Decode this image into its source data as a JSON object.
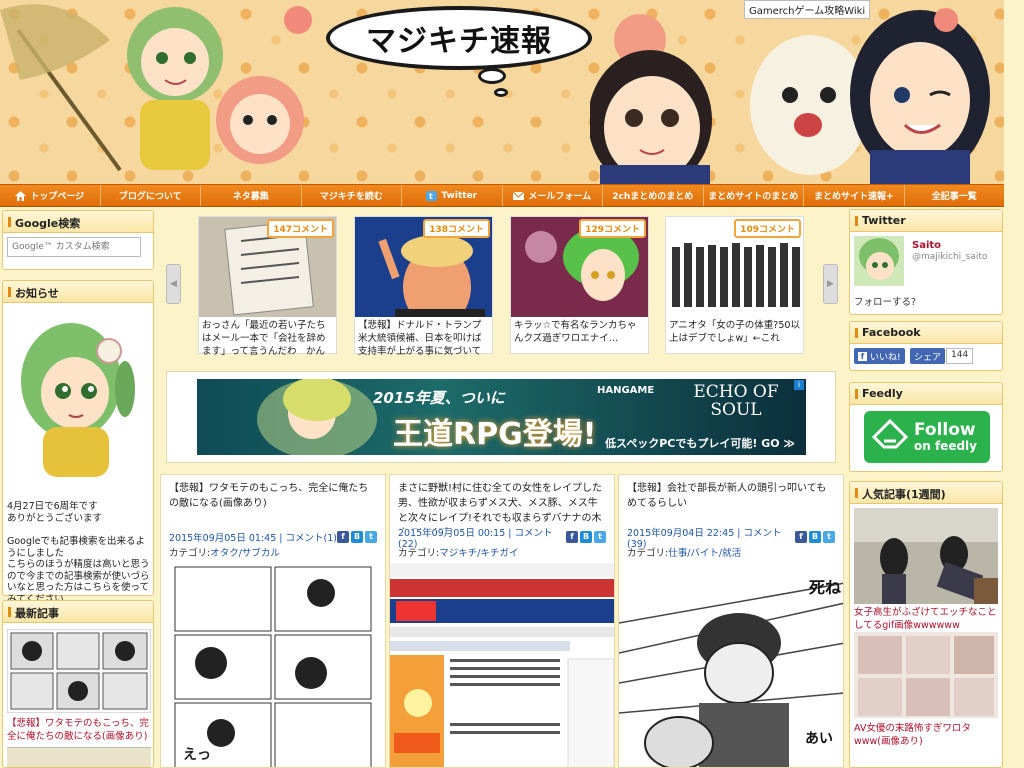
{
  "header": {
    "gmerch_label": "Gamerchゲーム攻略Wiki",
    "logo_text": "マジキチ速報"
  },
  "nav": [
    {
      "label": "トップページ",
      "icon": "home-icon"
    },
    {
      "label": "ブログについて"
    },
    {
      "label": "ネタ募集"
    },
    {
      "label": "マジキチを読む"
    },
    {
      "label": "Twitter",
      "icon": "twitter-icon"
    },
    {
      "label": "メールフォーム",
      "icon": "mail-icon"
    },
    {
      "label": "2chまとめのまとめ"
    },
    {
      "label": "まとめサイトのまとめ"
    },
    {
      "label": "まとめサイト速報+"
    },
    {
      "label": "全記事一覧"
    }
  ],
  "left": {
    "google_title": "Google検索",
    "search_placeholder": "Google™ カスタム検索",
    "notice_title": "お知らせ",
    "notice_text_1": "4月27日で6周年です",
    "notice_text_2": "ありがとうございます",
    "notice_text_3": "Googleでも記事検索を出来るようにしました",
    "notice_text_4": "こちらのほうが精度は高いと思うので今までの記事検索が使いづらいなと思った方はこちらを使ってみてください",
    "recent_title": "最新記事",
    "recent_item": "【悲報】ワタモテのもこっち、完全に俺たちの敵になる(画像あり)"
  },
  "slider": [
    {
      "count": "147コメント",
      "caption": "おっさん「最近の若い子たちはメール一本で「会社を辞めます」って言うんだわ　かんぺんし"
    },
    {
      "count": "138コメント",
      "caption": "【悲報】ドナルド・トランプ米大統領候補、日本を叩けば支持率が上がる事に気づいてしまう"
    },
    {
      "count": "129コメント",
      "caption": "キラッ☆で有名なランカちゃんクズ過ぎワロエナイ…"
    },
    {
      "count": "109コメント",
      "caption": "アニオタ「女の子の体重?50以上はデブでしょw」←これ"
    }
  ],
  "ad": {
    "headline": "2015年夏、ついに",
    "main": "王道RPG登場!",
    "brand": "HANGAME",
    "game": "ECHO OF SOUL",
    "sub": "低スペックPCでもプレイ可能! GO ≫"
  },
  "posts": [
    {
      "title": "【悲報】ワタモテのもこっち、完全に俺たちの敵になる(画像あり)",
      "date": "2015年09月05日 01:45",
      "comments": "コメント(1)",
      "cat_label": "カテゴリ:",
      "category": "オタク/サブカル"
    },
    {
      "title": "まさに野獣!村に住む全ての女性をレイプした男、性欲が収まらずメス犬、メス豚、メス牛と次々にレイプ!それでも収まらずバナナの木までレイプ",
      "date": "2015年09月05日 00:15",
      "comments": "コメント(22)",
      "cat_label": "カテゴリ:",
      "category": "マジキチ/キチガイ"
    },
    {
      "title": "【悲報】会社で部長が新人の頭引っ叩いてもめてるらしい",
      "date": "2015年09月04日 22:45",
      "comments": "コメント(39)",
      "cat_label": "カテゴリ:",
      "category": "仕事/バイト/就活"
    }
  ],
  "right": {
    "twitter_title": "Twitter",
    "tw_name": "Saito",
    "tw_handle": "@majikichi_saito",
    "tw_follow": "フォローする?",
    "facebook_title": "Facebook",
    "fb_like": "いいね!",
    "fb_share": "シェア",
    "fb_count": "144",
    "feedly_title": "Feedly",
    "feedly_follow": "Follow",
    "feedly_on": "on feedly",
    "popular_title": "人気記事(1週間)",
    "popular_1": "女子高生がふざけてエッチなことしてるgif画像wwwwww",
    "popular_2": "AV女優の末路怖すぎワロタwww(画像あり)"
  }
}
